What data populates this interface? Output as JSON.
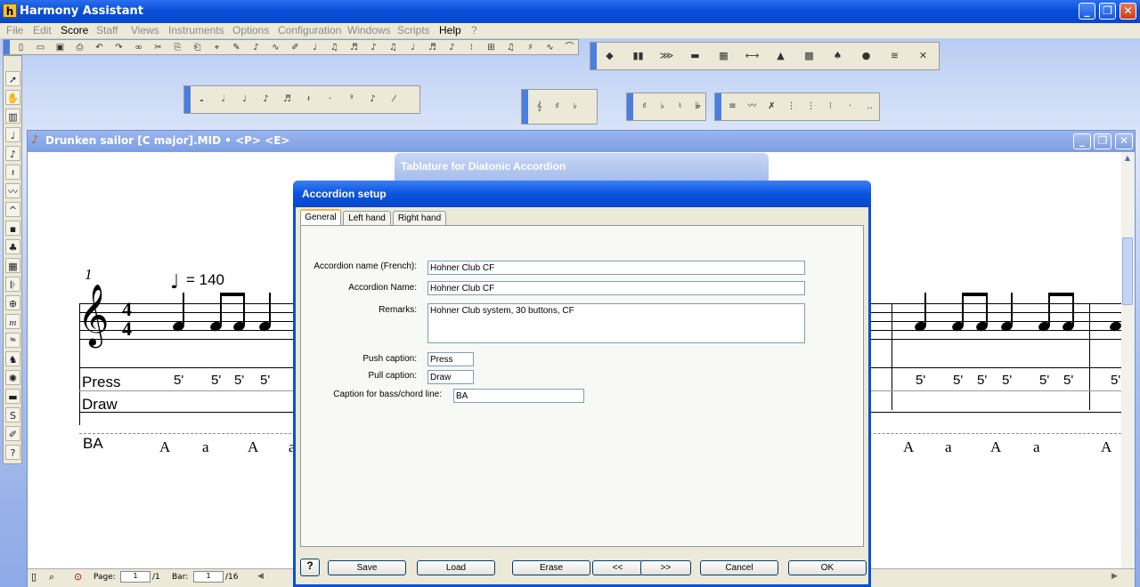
{
  "app": {
    "title": "Harmony Assistant",
    "logo": "h"
  },
  "menu": [
    "File",
    "Edit",
    "Score",
    "Staff",
    "Views",
    "Instruments",
    "Options",
    "Configuration",
    "Windows",
    "Scripts",
    "Help",
    "?"
  ],
  "menu_active": [
    "Score",
    "Help"
  ],
  "document": {
    "title": "Drunken sailor [C major].MID • <P> <E>"
  },
  "tablature_header": "Tablature for Diatonic Accordion",
  "score": {
    "measure_number": "1",
    "tempo": "= 140",
    "time_sig_top": "4",
    "time_sig_bottom": "4",
    "press_label": "Press",
    "draw_label": "Draw",
    "bass_label": "BA",
    "left_fingerings": [
      "5'",
      "5'",
      "5'",
      "5'"
    ],
    "left_bass": [
      "A",
      "a",
      "A",
      "a"
    ],
    "right_fingerings": [
      "5'",
      "5'",
      "5'",
      "5'",
      "5'",
      "5'",
      "5'"
    ],
    "right_bass": [
      "A",
      "a",
      "A",
      "a",
      "A"
    ]
  },
  "statusbar": {
    "page_label": "Page:",
    "page_value": "1",
    "page_total": "/1",
    "bar_label": "Bar:",
    "bar_value": "1",
    "bar_total": "/16"
  },
  "dialog": {
    "title": "Accordion setup",
    "tabs": [
      "General",
      "Left hand",
      "Right hand"
    ],
    "fields": {
      "name_fr_label": "Accordion name (French):",
      "name_fr_value": "Hohner Club CF",
      "name_label": "Accordion Name:",
      "name_value": "Hohner Club CF",
      "remarks_label": "Remarks:",
      "remarks_value": "Hohner Club system, 30 buttons, CF",
      "push_label": "Push caption:",
      "push_value": "Press",
      "pull_label": "Pull caption:",
      "pull_value": "Draw",
      "bass_label": "Caption for bass/chord line:",
      "bass_value": "BA"
    },
    "buttons": {
      "help": "?",
      "save": "Save",
      "load": "Load",
      "erase": "Erase",
      "prev": "<<",
      "next": ">>",
      "cancel": "Cancel",
      "ok": "OK"
    }
  },
  "colors": {
    "titlebar": "#0a4fd8",
    "dialog_bg": "#ece9d8",
    "tab_highlight": "#f9b33b"
  }
}
